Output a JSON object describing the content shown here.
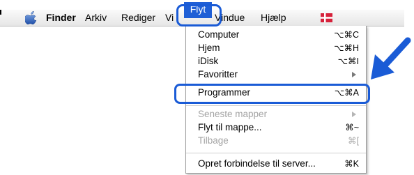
{
  "menubar": {
    "app_name": "Finder",
    "items": [
      "Arkiv",
      "Rediger",
      "Vi",
      "Flyt",
      "Vindue",
      "Hjælp"
    ],
    "active": "Flyt"
  },
  "menu": {
    "items": [
      {
        "label": "Computer",
        "shortcut": "⌥⌘C",
        "disabled": false
      },
      {
        "label": "Hjem",
        "shortcut": "⌥⌘H",
        "disabled": false
      },
      {
        "label": "iDisk",
        "shortcut": "⌥⌘I",
        "disabled": false
      },
      {
        "label": "Favoritter",
        "submenu": true,
        "disabled": false
      },
      {
        "label": "Programmer",
        "shortcut": "⌥⌘A",
        "disabled": false,
        "highlighted": true
      },
      {
        "label": "Seneste mapper",
        "submenu": true,
        "disabled": true
      },
      {
        "label": "Flyt til mappe...",
        "shortcut": "⌘~",
        "disabled": false
      },
      {
        "label": "Tilbage",
        "shortcut": "⌘[",
        "disabled": true
      },
      {
        "label": "Opret forbindelse til server...",
        "shortcut": "⌘K",
        "disabled": false
      }
    ]
  },
  "colors": {
    "highlight": "#1a5bd6",
    "flag_red": "#d6213a"
  },
  "icons": [
    "apple-icon",
    "denmark-flag-icon",
    "submenu-arrow-icon",
    "callout-arrow-icon"
  ]
}
